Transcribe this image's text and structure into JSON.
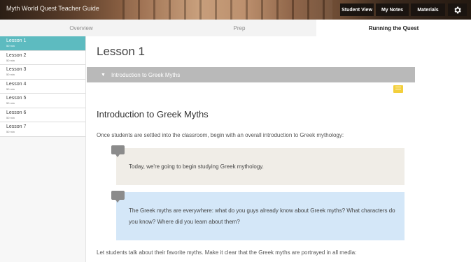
{
  "header": {
    "title": "Myth World Quest Teacher Guide",
    "buttons": [
      {
        "label": "Student View"
      },
      {
        "label": "My Notes"
      },
      {
        "label": "Materials"
      }
    ],
    "settings_icon": "gear-icon"
  },
  "tabs": [
    {
      "label": "Overview",
      "active": false
    },
    {
      "label": "Prep",
      "active": false
    },
    {
      "label": "Running the Quest",
      "active": true
    }
  ],
  "sidebar": {
    "lessons": [
      {
        "name": "Lesson 1",
        "time": "50 min",
        "active": true
      },
      {
        "name": "Lesson 2",
        "time": "50 min",
        "active": false
      },
      {
        "name": "Lesson 3",
        "time": "50 min",
        "active": false
      },
      {
        "name": "Lesson 4",
        "time": "50 min",
        "active": false
      },
      {
        "name": "Lesson 5",
        "time": "50 min",
        "active": false
      },
      {
        "name": "Lesson 6",
        "time": "50 min",
        "active": false
      },
      {
        "name": "Lesson 7",
        "time": "50 min",
        "active": false
      }
    ]
  },
  "main": {
    "lesson_title": "Lesson 1",
    "section_bar_label": "Introduction to Greek Myths",
    "section_heading": "Introduction to Greek Myths",
    "intro_text": "Once students are settled into the classroom, begin with an overall introduction to Greek mythology:",
    "quote1": "Today, we're going to begin studying Greek mythology.",
    "quote2": "The Greek myths are everywhere: what do you guys already know about Greek myths? What characters do you know? Where did you learn about them?",
    "closing_text": "Let students talk about their favorite myths. Make it clear that the Greek myths are portrayed in all media:"
  },
  "colors": {
    "active_lesson": "#5dbbc0",
    "section_bar": "#b9b9b9",
    "quote_teacher": "#f0ede7",
    "quote_question": "#d4e7f8",
    "note_icon": "#f3cf3c"
  }
}
